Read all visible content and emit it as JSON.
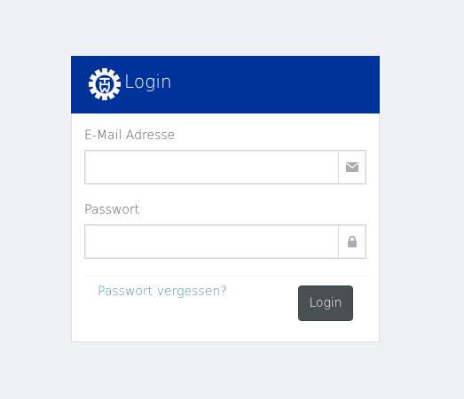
{
  "header": {
    "title": "Login",
    "background_color": "#003399",
    "logo_icon": "thw-gear-logo-icon"
  },
  "form": {
    "email": {
      "label": "E-Mail Adresse",
      "value": "",
      "placeholder": "",
      "addon_icon": "envelope-icon"
    },
    "password": {
      "label": "Passwort",
      "value": "",
      "placeholder": "",
      "addon_icon": "lock-icon"
    },
    "forgot_link_label": "Passwort vergessen?",
    "submit_label": "Login",
    "submit_color": "#4a5052",
    "link_color": "#4f8fbf"
  }
}
